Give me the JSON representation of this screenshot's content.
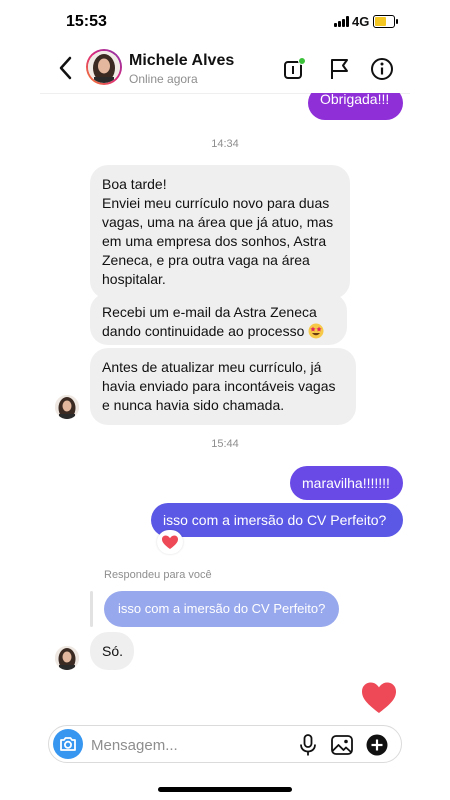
{
  "status_bar": {
    "time": "15:53",
    "network": "4G"
  },
  "header": {
    "name": "Michele Alves",
    "status": "Online agora"
  },
  "messages": {
    "top_out": "Obrigada!!!",
    "ts1": "14:34",
    "in1": "Boa tarde!\nEnviei meu currículo novo para duas vagas, uma na área que já atuo, mas em uma empresa dos sonhos, Astra Zeneca, e pra outra vaga na área hospitalar.",
    "in2": "Recebi um e-mail da Astra Zeneca dando continuidade ao processo",
    "in3": "Antes de atualizar meu currículo, já havia enviado para incontáveis vagas e nunca havia sido chamada.",
    "ts2": "15:44",
    "out1": "maravilha!!!!!!!",
    "out2": "isso com a imersão do CV Perfeito?",
    "reply_label": "Respondeu para você",
    "quoted": "isso com a imersão do CV Perfeito?",
    "in4": "Só."
  },
  "composer": {
    "placeholder": "Mensagem..."
  },
  "colors": {
    "outgoing_top": "#8f2fd8",
    "outgoing_purple": "#6a4ae6",
    "outgoing_blue": "#5b58e5",
    "accent": "#3797f0",
    "like_heart": "#ed4956"
  },
  "icons": [
    "back-icon",
    "video-call-icon",
    "flag-icon",
    "info-icon",
    "camera-icon",
    "microphone-icon",
    "gallery-icon",
    "add-icon",
    "heart-icon"
  ]
}
